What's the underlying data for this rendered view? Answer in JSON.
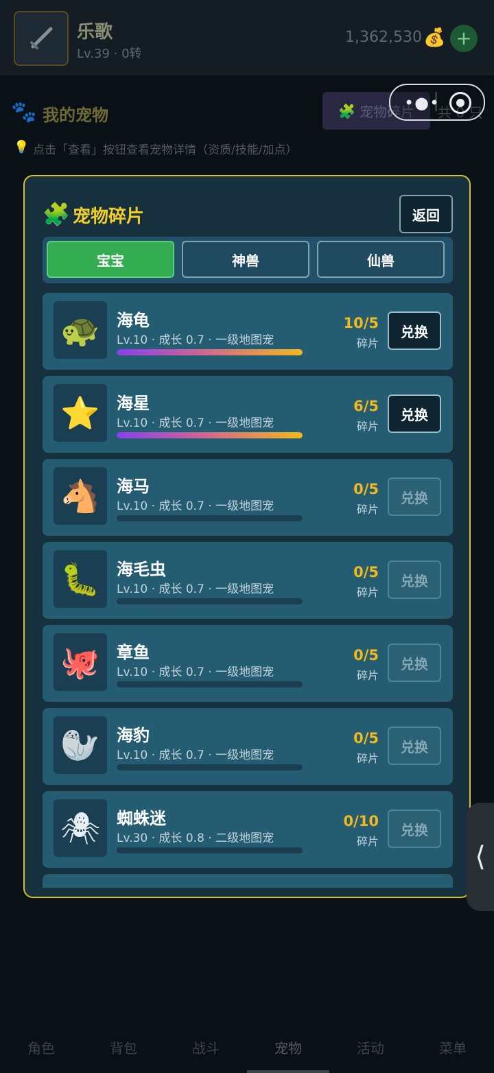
{
  "player": {
    "name": "乐歌",
    "level": "Lv.39 · 0转",
    "gold": "1,362,530",
    "gold_icon": "money-bag-icon"
  },
  "page": {
    "title": "我的宠物",
    "fragments_button": "宠物碎片",
    "total": "共 0 只",
    "tip": "点击「查看」按钮查看宠物详情（资质/技能/加点）"
  },
  "modal": {
    "title": "宠物碎片",
    "back": "返回",
    "tabs": [
      "宝宝",
      "神兽",
      "仙兽"
    ],
    "active_tab": "宝宝",
    "pets": [
      {
        "name": "海龟",
        "emoji": "🐢",
        "desc": "Lv.10 · 成长 0.7 · 一级地图宠",
        "count": "10/5",
        "unit": "碎片",
        "progress": 1.0,
        "exchange": "兑换",
        "can_exchange": true
      },
      {
        "name": "海星",
        "emoji": "⭐",
        "desc": "Lv.10 · 成长 0.7 · 一级地图宠",
        "count": "6/5",
        "unit": "碎片",
        "progress": 1.0,
        "exchange": "兑换",
        "can_exchange": true
      },
      {
        "name": "海马",
        "emoji": "🐴",
        "desc": "Lv.10 · 成长 0.7 · 一级地图宠",
        "count": "0/5",
        "unit": "碎片",
        "progress": 0,
        "exchange": "兑换",
        "can_exchange": false
      },
      {
        "name": "海毛虫",
        "emoji": "🐛",
        "desc": "Lv.10 · 成长 0.7 · 一级地图宠",
        "count": "0/5",
        "unit": "碎片",
        "progress": 0,
        "exchange": "兑换",
        "can_exchange": false
      },
      {
        "name": "章鱼",
        "emoji": "🐙",
        "desc": "Lv.10 · 成长 0.7 · 一级地图宠",
        "count": "0/5",
        "unit": "碎片",
        "progress": 0,
        "exchange": "兑换",
        "can_exchange": false
      },
      {
        "name": "海豹",
        "emoji": "🦭",
        "desc": "Lv.10 · 成长 0.7 · 一级地图宠",
        "count": "0/5",
        "unit": "碎片",
        "progress": 0,
        "exchange": "兑换",
        "can_exchange": false
      },
      {
        "name": "蜘蛛迷",
        "emoji": "🕷",
        "desc": "Lv.30 · 成长 0.8 · 二级地图宠",
        "count": "0/10",
        "unit": "碎片",
        "progress": 0,
        "exchange": "兑换",
        "can_exchange": false
      }
    ]
  },
  "nav": {
    "items": [
      "角色",
      "背包",
      "战斗",
      "宠物",
      "活动",
      "菜单"
    ],
    "active": "宠物"
  },
  "colors": {
    "accent": "#f2cf28",
    "tab_active": "#34ad52",
    "panel": "#16303d",
    "row": "#245c72"
  }
}
